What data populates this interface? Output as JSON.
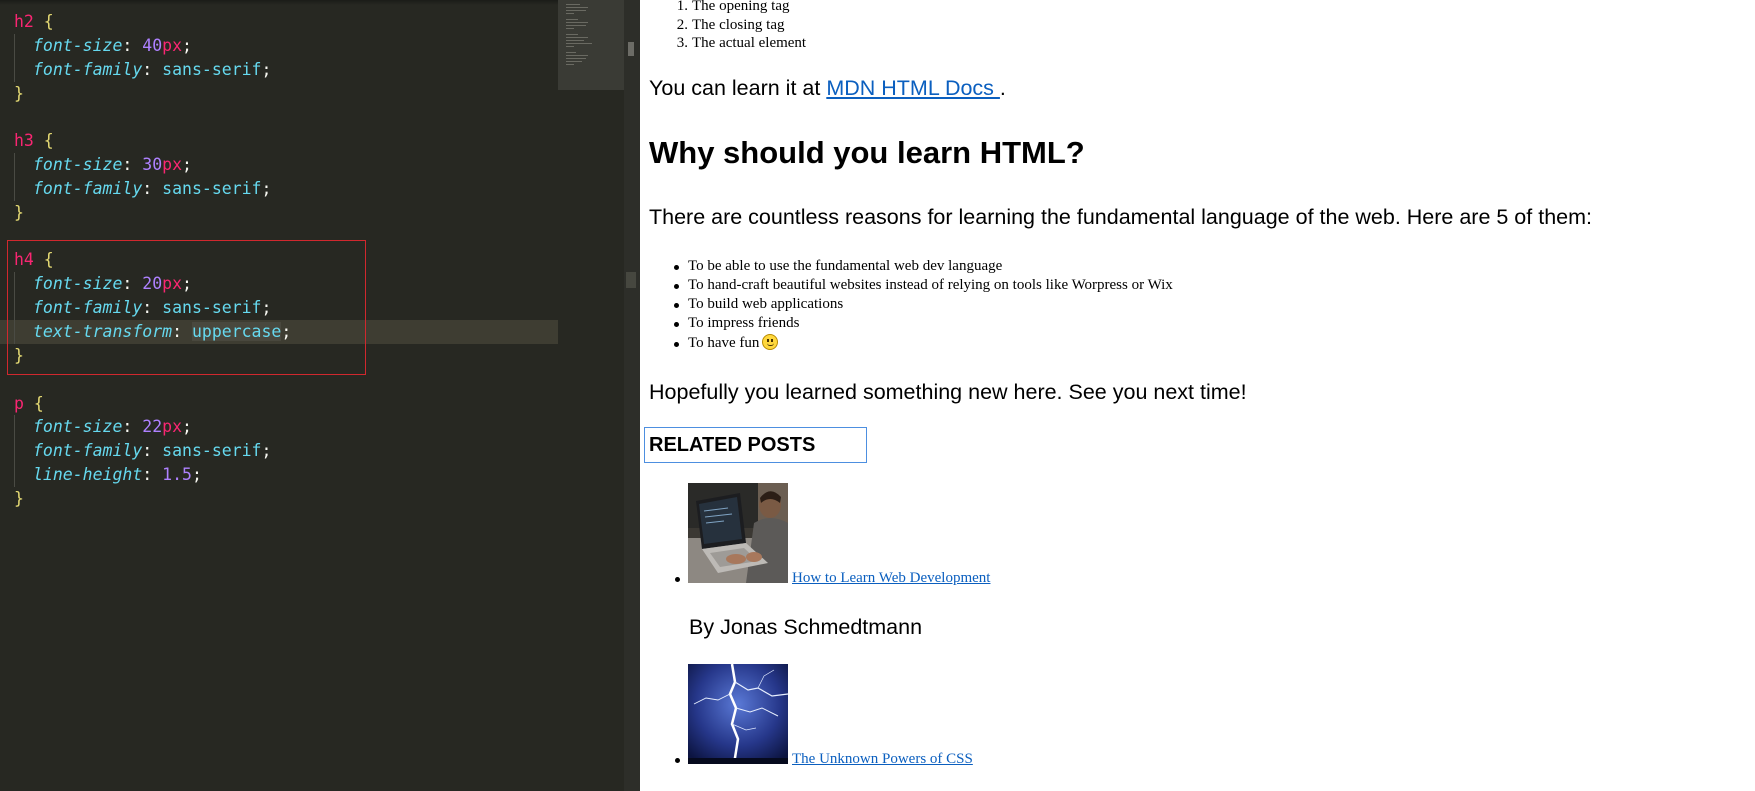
{
  "editor": {
    "code_blocks": [
      {
        "selector": "h2",
        "declarations": [
          {
            "property": "font-size",
            "number": "40",
            "unit": "px"
          },
          {
            "property": "font-family",
            "value": "sans-serif"
          }
        ]
      },
      {
        "selector": "h3",
        "declarations": [
          {
            "property": "font-size",
            "number": "30",
            "unit": "px"
          },
          {
            "property": "font-family",
            "value": "sans-serif"
          }
        ]
      },
      {
        "selector": "h4",
        "highlighted": true,
        "declarations": [
          {
            "property": "font-size",
            "number": "20",
            "unit": "px"
          },
          {
            "property": "font-family",
            "value": "sans-serif"
          },
          {
            "property": "text-transform",
            "value": "uppercase",
            "selected": true
          }
        ]
      },
      {
        "selector": "p",
        "declarations": [
          {
            "property": "font-size",
            "number": "22",
            "unit": "px"
          },
          {
            "property": "font-family",
            "value": "sans-serif"
          },
          {
            "property": "line-height",
            "number": "1.5",
            "unit": ""
          }
        ]
      }
    ]
  },
  "preview": {
    "ordered_list": [
      {
        "num": "1.",
        "text": "The opening tag"
      },
      {
        "num": "2.",
        "text": "The closing tag"
      },
      {
        "num": "3.",
        "text": "The actual element"
      }
    ],
    "learn_para": {
      "prefix": "You can learn it at ",
      "link": "MDN HTML Docs ",
      "suffix": "."
    },
    "why_heading": "Why should you learn HTML?",
    "reasons_para": "There are countless reasons for learning the fundamental language of the web. Here are 5 of them:",
    "reasons": [
      "To be able to use the fundamental web dev language",
      "To hand-craft beautiful websites instead of relying on tools like Worpress or Wix",
      "To build web applications",
      "To impress friends",
      "To have fun"
    ],
    "closing_para": "Hopefully you learned something new here. See you next time!",
    "related_heading": "RELATED POSTS",
    "posts": [
      {
        "title": "How to Learn Web Development",
        "image": "person-laptop-photo"
      },
      {
        "title": "The Unknown Powers of CSS",
        "image": "lightning-photo"
      }
    ],
    "author": "By Jonas Schmedtmann"
  }
}
